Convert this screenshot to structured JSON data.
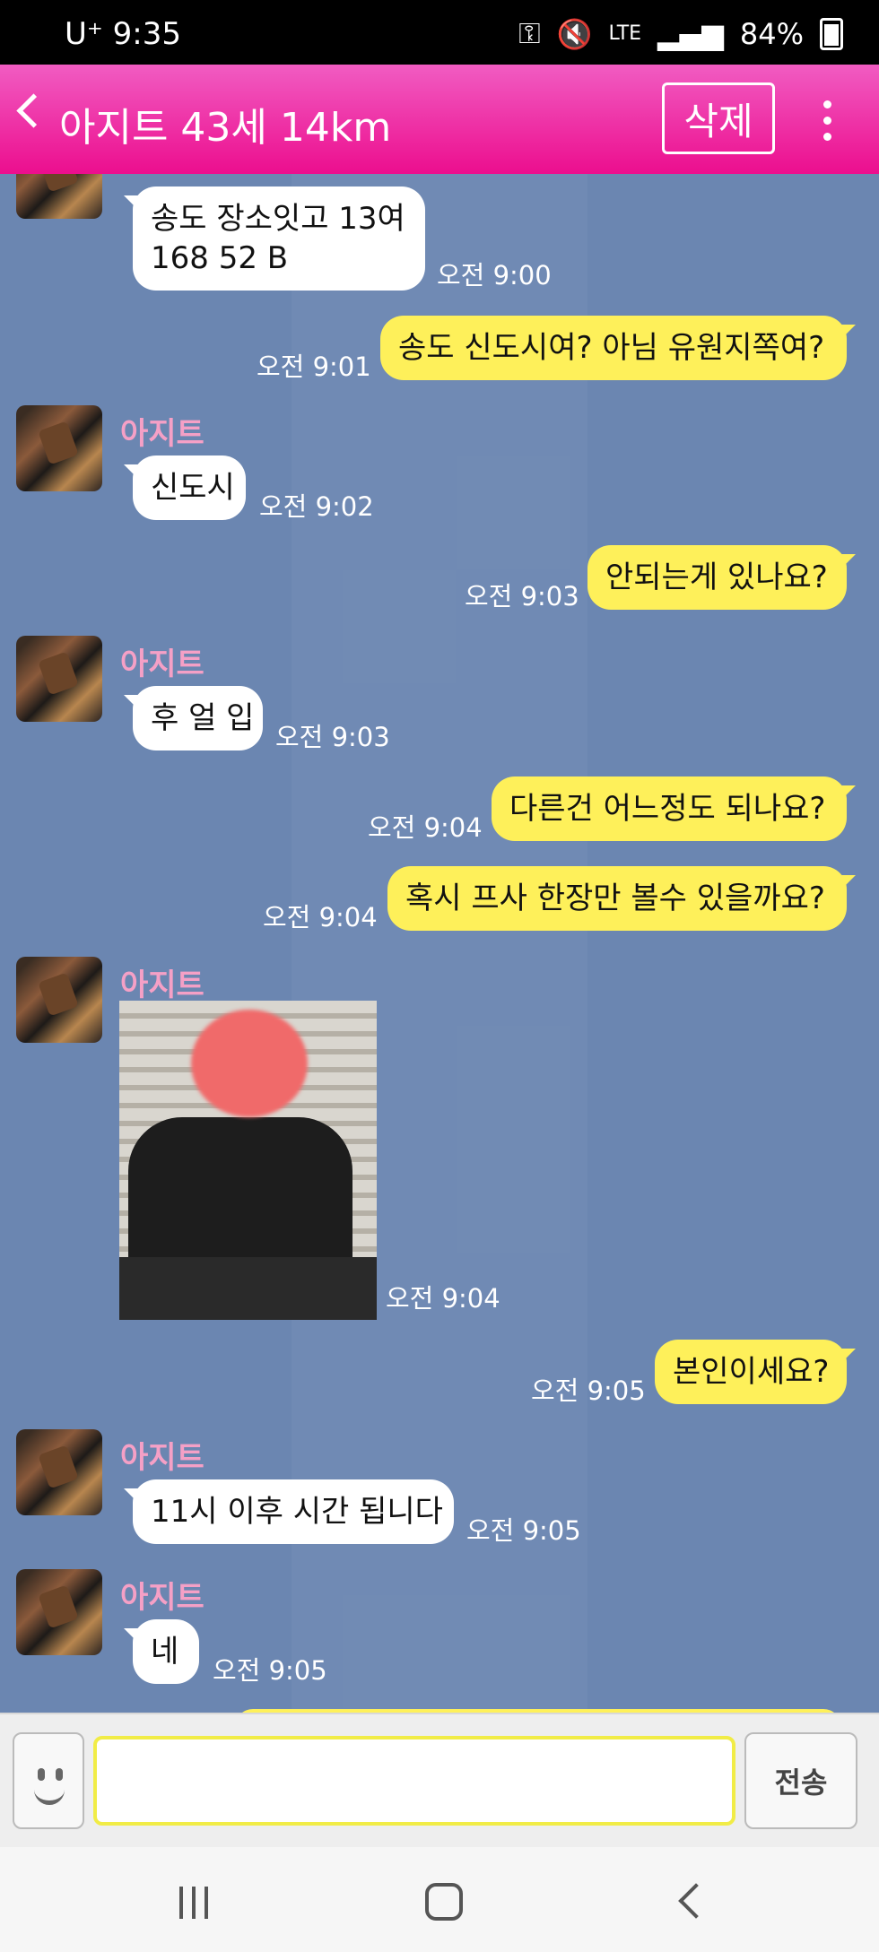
{
  "status_bar": {
    "carrier_time": "U⁺ 9:35",
    "network": "LTE",
    "battery": "84%"
  },
  "header": {
    "title": "아지트 43세 14km",
    "delete_label": "삭제"
  },
  "messages": {
    "m1": {
      "text_line1": "송도 장소잇고 13여",
      "text_line2": "168 52  B",
      "time": "오전 9:00"
    },
    "m2": {
      "text": "송도 신도시여? 아님 유원지쪽여?",
      "time": "오전 9:01"
    },
    "m3": {
      "sender": "아지트",
      "text": "신도시",
      "time": "오전 9:02"
    },
    "m4": {
      "text": "안되는게 있나요?",
      "time": "오전 9:03"
    },
    "m5": {
      "sender": "아지트",
      "text": "후 얼 입",
      "time": "오전 9:03"
    },
    "m6": {
      "text": "다른건 어느정도 되나요?",
      "time": "오전 9:04"
    },
    "m7": {
      "text": "혹시 프사 한장만 볼수 있을까요?",
      "time": "오전 9:04"
    },
    "m8": {
      "sender": "아지트",
      "time": "오전 9:04"
    },
    "m9": {
      "text": "본인이세요?",
      "time": "오전 9:05"
    },
    "m10": {
      "sender": "아지트",
      "text": "11시 이후 시간 됩니다",
      "time": "오전 9:05"
    },
    "m11": {
      "sender": "아지트",
      "text": "네",
      "time": "오전 9:05"
    }
  },
  "input": {
    "placeholder": "",
    "send_label": "전송"
  }
}
